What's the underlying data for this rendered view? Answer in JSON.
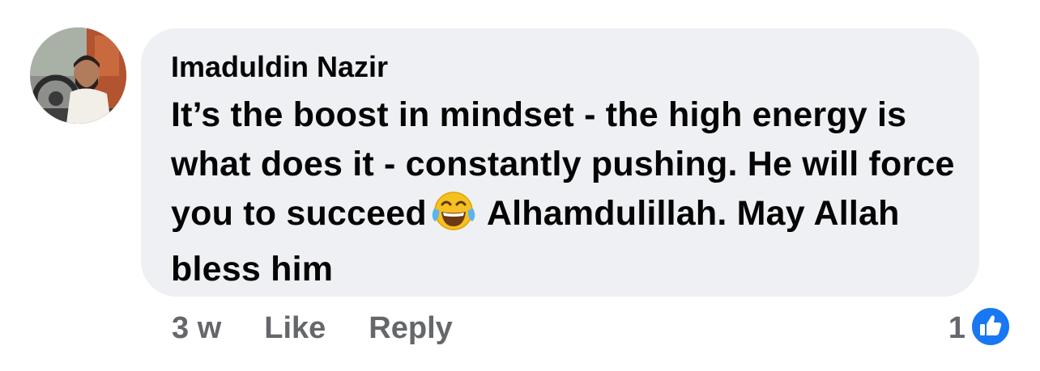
{
  "comment": {
    "author": "Imaduldin Nazir",
    "text_before_emoji": "It’s the boost in mindset - the high energy is what does it - constantly pushing. He will force you to succeed",
    "emoji": "face-with-tears-of-joy-icon",
    "text_after_emoji": "Alhamdulillah. May Allah bless him",
    "timestamp": "3 w",
    "like_label": "Like",
    "reply_label": "Reply",
    "reaction_count": "1",
    "reaction_type": "like-reaction-icon"
  },
  "colors": {
    "bubble_bg": "#eff0f3",
    "text": "#050505",
    "meta_text": "#65676b",
    "like_blue": "#1877f2"
  }
}
